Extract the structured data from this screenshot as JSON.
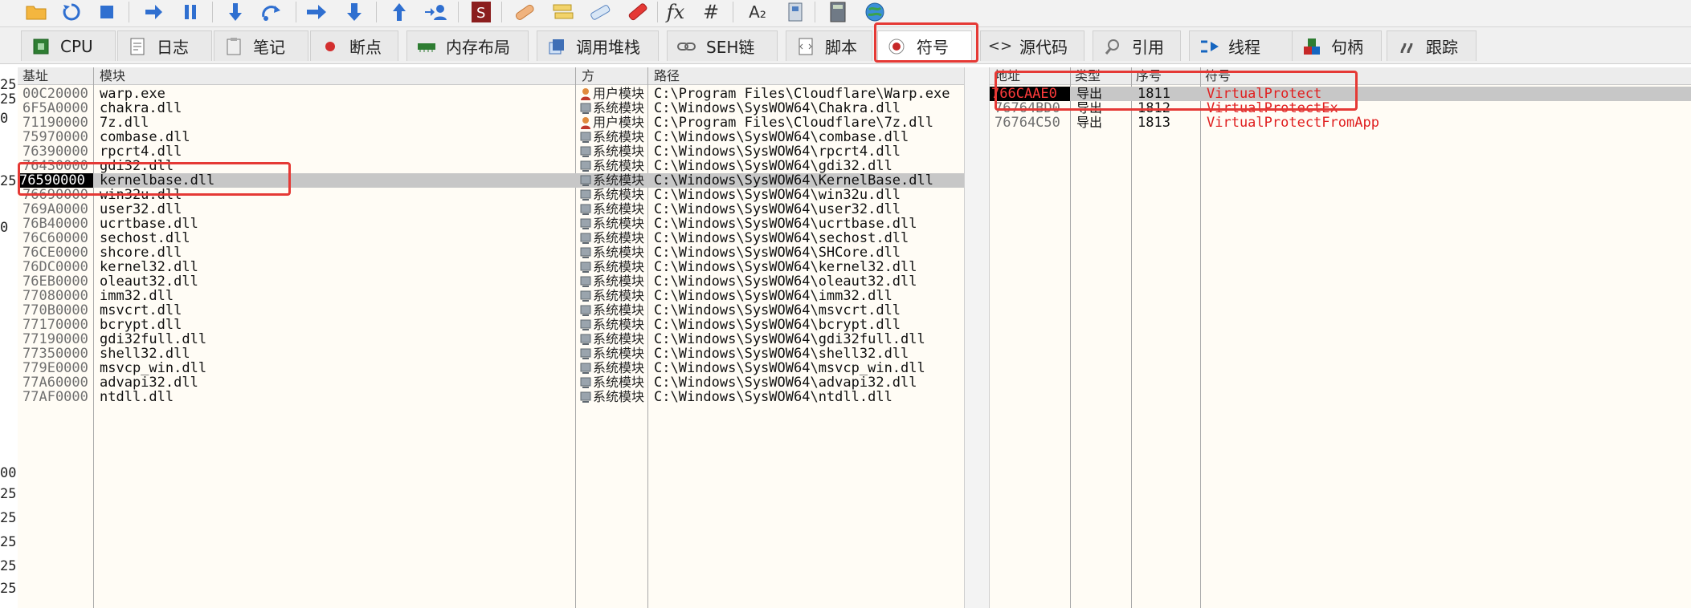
{
  "toolbar": {
    "icons": [
      "open-folder-icon",
      "restart-icon",
      "stop-icon",
      "run-icon",
      "pause-icon",
      "step-into-icon",
      "step-over-icon",
      "run-to-user-icon",
      "step-into-alt-icon",
      "execute-till-return-icon",
      "run-to-user-code-icon",
      "scylla-icon",
      "patch-icon",
      "comment-icon",
      "label-icon",
      "bookmark-icon",
      "function-icon",
      "hash-icon",
      "font-icon",
      "calculator-icon",
      "globe-icon"
    ],
    "fx_label": "fx",
    "hash_label": "#",
    "font_label": "A₂"
  },
  "tabs": [
    {
      "label": "CPU",
      "icon": "cpu-icon",
      "color": "#2e7d32"
    },
    {
      "label": "日志",
      "icon": "log-icon",
      "color": "#555555"
    },
    {
      "label": "笔记",
      "icon": "notes-icon",
      "color": "#555555"
    },
    {
      "label": "断点",
      "icon": "breakpoint-icon",
      "color": "#d32f2f"
    },
    {
      "label": "内存布局",
      "icon": "memory-map-icon",
      "color": "#2e7d32"
    },
    {
      "label": "调用堆栈",
      "icon": "call-stack-icon",
      "color": "#3f6fb6"
    },
    {
      "label": "SEH链",
      "icon": "seh-chain-icon",
      "color": "#666666"
    },
    {
      "label": "脚本",
      "icon": "script-icon",
      "color": "#555555"
    },
    {
      "label": "符号",
      "icon": "symbols-icon",
      "color": "#c62828",
      "active": true
    },
    {
      "label": "源代码",
      "icon": "source-icon",
      "color": "#333333"
    },
    {
      "label": "引用",
      "icon": "references-icon",
      "color": "#555555"
    },
    {
      "label": "线程",
      "icon": "threads-icon",
      "color": "#1565c0"
    },
    {
      "label": "句柄",
      "icon": "handles-icon",
      "color": "#c62828"
    },
    {
      "label": "跟踪",
      "icon": "trace-icon",
      "color": "#555555"
    }
  ],
  "modules_pane": {
    "headers": {
      "base": "基址",
      "module": "模块",
      "party": "方",
      "path": "路径"
    },
    "rows": [
      {
        "base": "00C20000",
        "module": "warp.exe",
        "party": "用户模块",
        "party_icon": "user-module-icon",
        "path": "C:\\Program Files\\Cloudflare\\Warp.exe"
      },
      {
        "base": "6F5A0000",
        "module": "chakra.dll",
        "party": "系统模块",
        "party_icon": "system-module-icon",
        "path": "C:\\Windows\\SysWOW64\\Chakra.dll"
      },
      {
        "base": "71190000",
        "module": "7z.dll",
        "party": "用户模块",
        "party_icon": "user-module-icon",
        "path": "C:\\Program Files\\Cloudflare\\7z.dll"
      },
      {
        "base": "75970000",
        "module": "combase.dll",
        "party": "系统模块",
        "party_icon": "system-module-icon",
        "path": "C:\\Windows\\SysWOW64\\combase.dll"
      },
      {
        "base": "76390000",
        "module": "rpcrt4.dll",
        "party": "系统模块",
        "party_icon": "system-module-icon",
        "path": "C:\\Windows\\SysWOW64\\rpcrt4.dll"
      },
      {
        "base": "76430000",
        "module": "gdi32.dll",
        "party": "系统模块",
        "party_icon": "system-module-icon",
        "path": "C:\\Windows\\SysWOW64\\gdi32.dll"
      },
      {
        "base": "76590000",
        "module": "kernelbase.dll",
        "party": "系统模块",
        "party_icon": "system-module-icon",
        "path": "C:\\Windows\\SysWOW64\\KernelBase.dll",
        "selected": true
      },
      {
        "base": "76690000",
        "module": "win32u.dll",
        "party": "系统模块",
        "party_icon": "system-module-icon",
        "path": "C:\\Windows\\SysWOW64\\win32u.dll"
      },
      {
        "base": "769A0000",
        "module": "user32.dll",
        "party": "系统模块",
        "party_icon": "system-module-icon",
        "path": "C:\\Windows\\SysWOW64\\user32.dll"
      },
      {
        "base": "76B40000",
        "module": "ucrtbase.dll",
        "party": "系统模块",
        "party_icon": "system-module-icon",
        "path": "C:\\Windows\\SysWOW64\\ucrtbase.dll"
      },
      {
        "base": "76C60000",
        "module": "sechost.dll",
        "party": "系统模块",
        "party_icon": "system-module-icon",
        "path": "C:\\Windows\\SysWOW64\\sechost.dll"
      },
      {
        "base": "76CE0000",
        "module": "shcore.dll",
        "party": "系统模块",
        "party_icon": "system-module-icon",
        "path": "C:\\Windows\\SysWOW64\\SHCore.dll"
      },
      {
        "base": "76DC0000",
        "module": "kernel32.dll",
        "party": "系统模块",
        "party_icon": "system-module-icon",
        "path": "C:\\Windows\\SysWOW64\\kernel32.dll"
      },
      {
        "base": "76EB0000",
        "module": "oleaut32.dll",
        "party": "系统模块",
        "party_icon": "system-module-icon",
        "path": "C:\\Windows\\SysWOW64\\oleaut32.dll"
      },
      {
        "base": "77080000",
        "module": "imm32.dll",
        "party": "系统模块",
        "party_icon": "system-module-icon",
        "path": "C:\\Windows\\SysWOW64\\imm32.dll"
      },
      {
        "base": "770B0000",
        "module": "msvcrt.dll",
        "party": "系统模块",
        "party_icon": "system-module-icon",
        "path": "C:\\Windows\\SysWOW64\\msvcrt.dll"
      },
      {
        "base": "77170000",
        "module": "bcrypt.dll",
        "party": "系统模块",
        "party_icon": "system-module-icon",
        "path": "C:\\Windows\\SysWOW64\\bcrypt.dll"
      },
      {
        "base": "77190000",
        "module": "gdi32full.dll",
        "party": "系统模块",
        "party_icon": "system-module-icon",
        "path": "C:\\Windows\\SysWOW64\\gdi32full.dll"
      },
      {
        "base": "77350000",
        "module": "shell32.dll",
        "party": "系统模块",
        "party_icon": "system-module-icon",
        "path": "C:\\Windows\\SysWOW64\\shell32.dll"
      },
      {
        "base": "779E0000",
        "module": "msvcp_win.dll",
        "party": "系统模块",
        "party_icon": "system-module-icon",
        "path": "C:\\Windows\\SysWOW64\\msvcp_win.dll"
      },
      {
        "base": "77A60000",
        "module": "advapi32.dll",
        "party": "系统模块",
        "party_icon": "system-module-icon",
        "path": "C:\\Windows\\SysWOW64\\advapi32.dll"
      },
      {
        "base": "77AF0000",
        "module": "ntdll.dll",
        "party": "系统模块",
        "party_icon": "system-module-icon",
        "path": "C:\\Windows\\SysWOW64\\ntdll.dll"
      }
    ]
  },
  "symbols_pane": {
    "headers": {
      "address": "地址",
      "type": "类型",
      "ordinal": "序号",
      "symbol": "符号"
    },
    "rows": [
      {
        "address": "766CAAE0",
        "type": "导出",
        "ordinal": "1811",
        "symbol": "VirtualProtect",
        "selected": true
      },
      {
        "address": "76764BD0",
        "type": "导出",
        "ordinal": "1812",
        "symbol": "VirtualProtectEx"
      },
      {
        "address": "76764C50",
        "type": "导出",
        "ordinal": "1813",
        "symbol": "VirtualProtectFromApp"
      }
    ]
  },
  "gutter_labels": [
    "25",
    "25",
    "0",
    "25",
    "0",
    "00",
    "25",
    "25",
    "25",
    "25",
    "25"
  ],
  "colors": {
    "annotation": "#e53935",
    "symbol_text": "#e02020",
    "selected_row": "#c7c7c7"
  }
}
